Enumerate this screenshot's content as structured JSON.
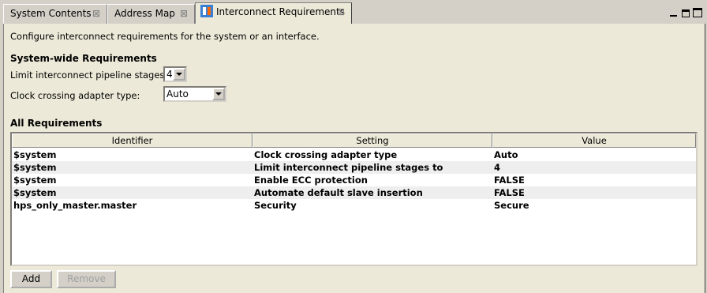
{
  "tabs": [
    {
      "label": "System Contents",
      "close": "⊠"
    },
    {
      "label": "Address Map",
      "close": "⊠"
    },
    {
      "label": "Interconnect Requirements",
      "close": "⊠"
    }
  ],
  "description": "Configure interconnect requirements for the system or an interface.",
  "system_wide": {
    "title": "System-wide Requirements",
    "pipeline_label": "Limit interconnect pipeline stages to:",
    "pipeline_value": "4",
    "clock_label": "Clock crossing adapter type:",
    "clock_value": "Auto"
  },
  "all_requirements": {
    "title": "All Requirements",
    "columns": [
      "Identifier",
      "Setting",
      "Value"
    ],
    "rows": [
      {
        "identifier": "$system",
        "setting": "Clock crossing adapter type",
        "value": "Auto"
      },
      {
        "identifier": "$system",
        "setting": "Limit interconnect pipeline stages to",
        "value": "4"
      },
      {
        "identifier": "$system",
        "setting": "Enable ECC protection",
        "value": "FALSE"
      },
      {
        "identifier": "$system",
        "setting": "Automate default slave insertion",
        "value": "FALSE"
      },
      {
        "identifier": "hps_only_master.master",
        "setting": "Security",
        "value": "Secure"
      }
    ]
  },
  "buttons": {
    "add": "Add",
    "remove": "Remove"
  }
}
